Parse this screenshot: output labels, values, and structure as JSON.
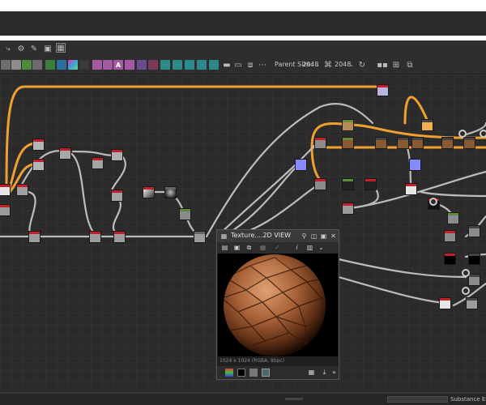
{
  "toolbar": {
    "parent_size_label": "Parent Size:",
    "parent_size_value": "2048",
    "output_size_value": "2048"
  },
  "view2d": {
    "title": "Texture....2D VIEW",
    "info": "1024 x 1024 (RGBA, 8bpc)"
  },
  "status": {
    "text": "Substance Engi"
  },
  "colors": {
    "graph_bg": "#2b2b2b",
    "orange_wire": "#f0a030",
    "gray_wire": "#bcbcbc",
    "node_header_red": "#c0202a",
    "panel_bg": "#2e2e2e"
  },
  "icons": {
    "toolbar_left": [
      "connect-icon",
      "gear-icon",
      "wrench-icon",
      "export-icon",
      "frame-icon"
    ],
    "view2d": [
      "pin-icon",
      "dock-icon",
      "fit-icon",
      "close-icon"
    ]
  }
}
